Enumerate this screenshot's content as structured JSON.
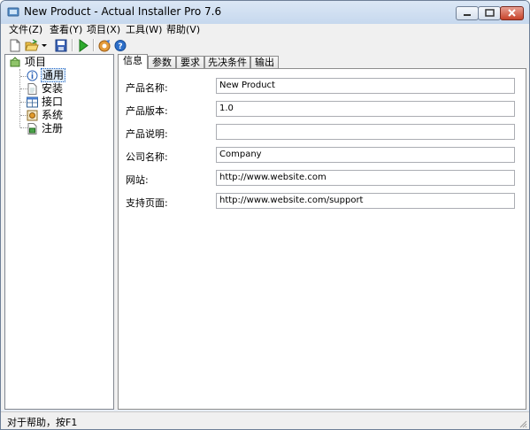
{
  "window": {
    "title": "New Product - Actual Installer Pro 7.6",
    "controls": [
      "minimize",
      "maximize",
      "close"
    ]
  },
  "menu": [
    {
      "label": "文件(Z)"
    },
    {
      "label": "查看(Y)"
    },
    {
      "label": "项目(X)"
    },
    {
      "label": "工具(W)"
    },
    {
      "label": "帮助(V)"
    }
  ],
  "toolbar": {
    "icons": [
      "new-file-icon",
      "open-folder-icon",
      "dropdown-arrow-icon",
      "save-icon",
      "build-run-icon",
      "settings-icon",
      "help-icon"
    ]
  },
  "tree": {
    "root": "项目",
    "items": [
      {
        "label": "通用",
        "icon": "info-icon",
        "selected": true
      },
      {
        "label": "安装",
        "icon": "document-icon",
        "selected": false
      },
      {
        "label": "接口",
        "icon": "window-grid-icon",
        "selected": false
      },
      {
        "label": "系统",
        "icon": "system-icon",
        "selected": false
      },
      {
        "label": "注册",
        "icon": "registry-icon",
        "selected": false
      }
    ]
  },
  "tabs": [
    {
      "label": "信息",
      "active": true
    },
    {
      "label": "参数",
      "active": false
    },
    {
      "label": "要求",
      "active": false
    },
    {
      "label": "先决条件",
      "active": false
    },
    {
      "label": "输出",
      "active": false
    }
  ],
  "form": {
    "fields": [
      {
        "label": "产品名称:",
        "value": "New Product"
      },
      {
        "label": "产品版本:",
        "value": "1.0"
      },
      {
        "label": "产品说明:",
        "value": ""
      },
      {
        "label": "公司名称:",
        "value": "Company"
      },
      {
        "label": "网站:",
        "value": "http://www.website.com"
      },
      {
        "label": "支持页面:",
        "value": "http://www.website.com/support"
      }
    ]
  },
  "status": {
    "text": "对于帮助，按F1"
  }
}
